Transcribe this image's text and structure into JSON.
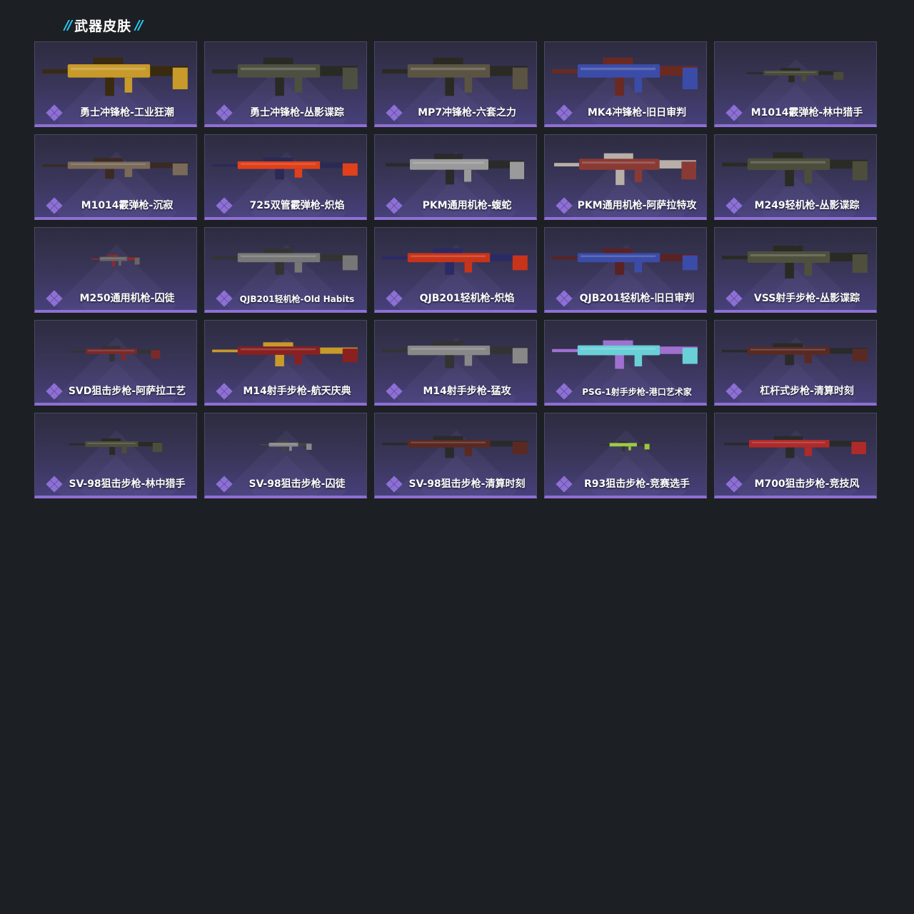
{
  "section": {
    "title": "武器皮肤",
    "slash_left": "//",
    "slash_right": "//"
  },
  "colors": {
    "background": "#1c2025",
    "accent_cyan": "#27d3ff",
    "card_border_bottom": "#8f6fd3",
    "rank_icon": "#8e6fd6"
  },
  "skins": [
    {
      "name": "勇士冲锋枪-工业狂潮",
      "icon": "smg-gold",
      "colors": [
        "#c89a2a",
        "#3a2a10"
      ]
    },
    {
      "name": "勇士冲锋枪-丛影谍踪",
      "icon": "smg-camo",
      "colors": [
        "#4d5040",
        "#2a2a25"
      ]
    },
    {
      "name": "MP7冲锋枪-六套之力",
      "icon": "smg-camo",
      "colors": [
        "#5b5443",
        "#2b2924"
      ]
    },
    {
      "name": "MK4冲锋枪-旧日审判",
      "icon": "smg-blue",
      "colors": [
        "#3b4ca8",
        "#6a2a22"
      ]
    },
    {
      "name": "M1014霰弹枪-林中猎手",
      "icon": "shotgun-camo",
      "colors": [
        "#4a4b3a",
        "#2a2a22"
      ]
    },
    {
      "name": "M1014霰弹枪-沉寂",
      "icon": "shotgun-wood",
      "colors": [
        "#7a6a5a",
        "#3a2a22"
      ]
    },
    {
      "name": "725双管霰弹枪-炽焰",
      "icon": "shotgun-flame",
      "colors": [
        "#e0401a",
        "#2a2a55"
      ]
    },
    {
      "name": "PKM通用机枪-蝮蛇",
      "icon": "mg-snake",
      "colors": [
        "#9a9a9a",
        "#2a2a2a"
      ]
    },
    {
      "name": "PKM通用机枪-阿萨拉特攻",
      "icon": "mg-red",
      "colors": [
        "#8a3a34",
        "#b8b0a8"
      ]
    },
    {
      "name": "M249轻机枪-丛影谍踪",
      "icon": "mg-camo",
      "colors": [
        "#4c4e3b",
        "#2a2b24"
      ]
    },
    {
      "name": "M250通用机枪-囚徒",
      "icon": "mg-small",
      "colors": [
        "#666",
        "#8a2a2a"
      ]
    },
    {
      "name": "QJB201轻机枪-Old Habits",
      "icon": "lmg-grey",
      "colors": [
        "#777",
        "#333"
      ]
    },
    {
      "name": "QJB201轻机枪-炽焰",
      "icon": "lmg-flame",
      "colors": [
        "#c8341a",
        "#2a2a66"
      ]
    },
    {
      "name": "QJB201轻机枪-旧日审判",
      "icon": "lmg-blue",
      "colors": [
        "#3b4ca8",
        "#5a2222"
      ]
    },
    {
      "name": "VSS射手步枪-丛影谍踪",
      "icon": "dmr-camo",
      "colors": [
        "#4e503d",
        "#2a2a24"
      ]
    },
    {
      "name": "SVD狙击步枪-阿萨拉工艺",
      "icon": "sniper-red",
      "colors": [
        "#7a2a2a",
        "#333"
      ]
    },
    {
      "name": "M14射手步枪-航天庆典",
      "icon": "dmr-red",
      "colors": [
        "#8a2020",
        "#c89a2a"
      ]
    },
    {
      "name": "M14射手步枪-猛攻",
      "icon": "dmr-grey",
      "colors": [
        "#888",
        "#333"
      ]
    },
    {
      "name": "PSG-1射手步枪-港口艺术家",
      "icon": "dmr-art",
      "colors": [
        "#6ad0d8",
        "#a070d0"
      ]
    },
    {
      "name": "杠杆式步枪-清算时刻",
      "icon": "lever-wood",
      "colors": [
        "#5a2a22",
        "#2a2a2a"
      ]
    },
    {
      "name": "SV-98狙击步枪-林中猎手",
      "icon": "sniper-camo",
      "colors": [
        "#4c4e3b",
        "#2a2b24"
      ]
    },
    {
      "name": "SV-98狙击步枪-囚徒",
      "icon": "sniper-small",
      "colors": [
        "#888",
        "#444"
      ]
    },
    {
      "name": "SV-98狙击步枪-清算时刻",
      "icon": "sniper-wood",
      "colors": [
        "#5a2a22",
        "#2a2a2a"
      ]
    },
    {
      "name": "R93狙击步枪-竞赛选手",
      "icon": "sniper-green",
      "colors": [
        "#9ac83a",
        "#333"
      ]
    },
    {
      "name": "M700狙击步枪-竞技风",
      "icon": "sniper-red",
      "colors": [
        "#b02a2a",
        "#2a2a2a"
      ]
    }
  ]
}
